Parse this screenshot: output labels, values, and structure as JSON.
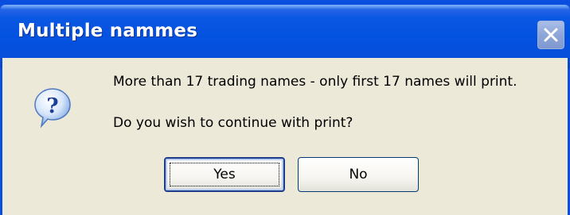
{
  "dialog": {
    "title": "Multiple nammes",
    "close_icon": "close-icon",
    "icon": "question-icon",
    "message_line1": "More than 17 trading names - only first 17 names will print.",
    "message_line2": "Do you wish to continue with print?",
    "buttons": {
      "yes_label": "Yes",
      "no_label": "No"
    },
    "colors": {
      "titlebar": "#0452e0",
      "client_background": "#ece9d8",
      "close_button": "#8ea6d8"
    }
  }
}
